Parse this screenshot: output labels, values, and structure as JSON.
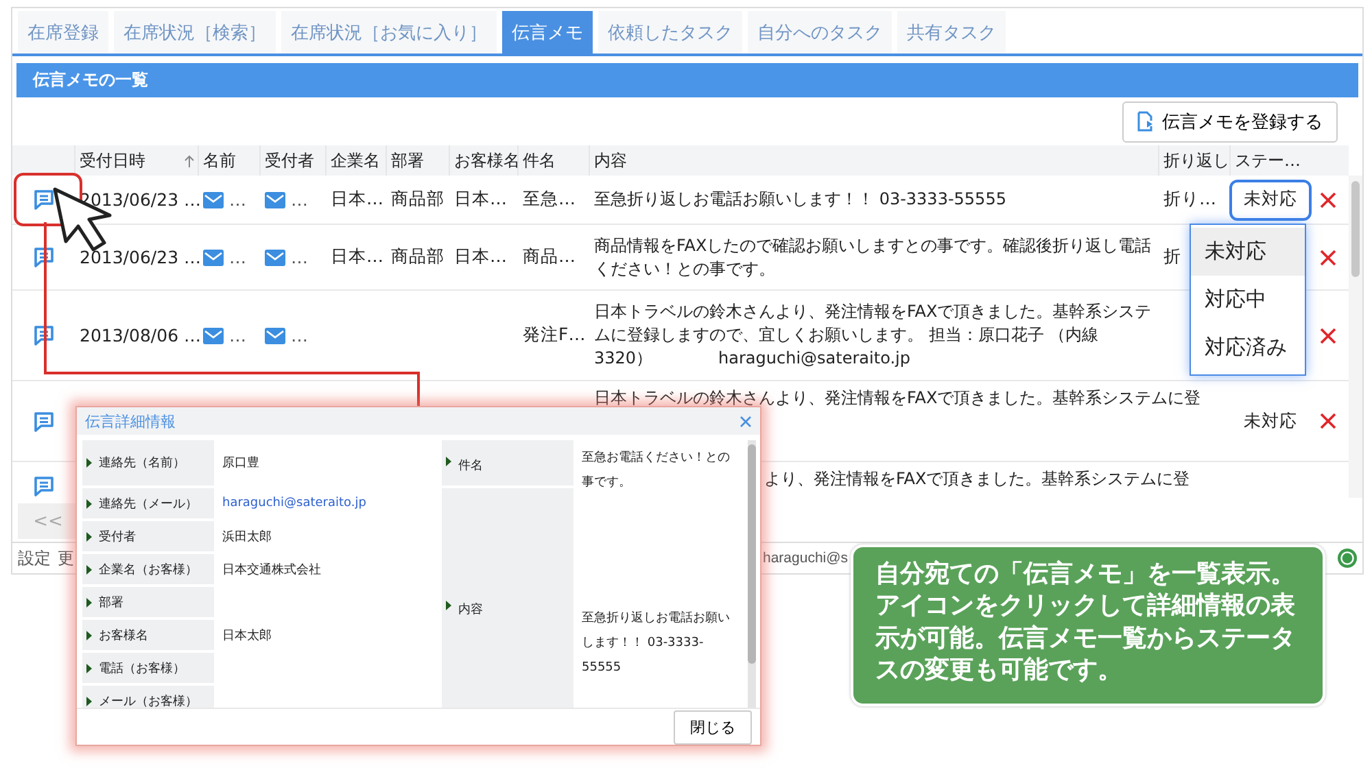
{
  "tabs": [
    {
      "label": "在席登録",
      "selected": false
    },
    {
      "label": "在席状況［検索］",
      "selected": false
    },
    {
      "label": "在席状況［お気に入り］",
      "selected": false
    },
    {
      "label": "伝言メモ",
      "selected": true
    },
    {
      "label": "依頼したタスク",
      "selected": false
    },
    {
      "label": "自分へのタスク",
      "selected": false
    },
    {
      "label": "共有タスク",
      "selected": false
    }
  ],
  "panel_title": "伝言メモの一覧",
  "register_button": "伝言メモを登録する",
  "table": {
    "columns": [
      {
        "label": "受付日時",
        "sorted": true
      },
      {
        "label": "名前",
        "sorted": false
      },
      {
        "label": "受付者",
        "sorted": false
      },
      {
        "label": "企業名",
        "sorted": false
      },
      {
        "label": "部署",
        "sorted": false
      },
      {
        "label": "お客様名",
        "sorted": false
      },
      {
        "label": "件名",
        "sorted": false
      },
      {
        "label": "内容",
        "sorted": false
      },
      {
        "label": "折り返し",
        "sorted": false
      },
      {
        "label": "ステー…",
        "sorted": false
      }
    ],
    "rows": [
      {
        "kind": "full",
        "date": "2013/06/23 …",
        "name": "…",
        "receiver": "…",
        "company": "日本…",
        "department": "商品部",
        "customer": "日本…",
        "subject": "至急…",
        "content": "至急折り返しお電話お願いします！！ 03-3333-55555",
        "callback": "折り…",
        "status": "未対応",
        "status_menu": {
          "open": true,
          "options": [
            {
              "label": "未対応",
              "selected": true
            },
            {
              "label": "対応中",
              "selected": false
            },
            {
              "label": "対応済み",
              "selected": false
            }
          ]
        }
      },
      {
        "kind": "full",
        "date": "2013/06/23 …",
        "name": "…",
        "receiver": "…",
        "company": "日本…",
        "department": "商品部",
        "customer": "日本…",
        "subject": "商品…",
        "content": "商品情報をFAXしたので確認お願いしますとの事です。確認後折り返し電話ください！との事です。",
        "callback": "折"
      },
      {
        "kind": "full",
        "date": "2013/08/06 …",
        "name": "…",
        "receiver": "…",
        "subject": "発注F…",
        "content": "日本トラベルの鈴木さんより、発注情報をFAXで頂きました。基幹系システムに登録しますので、宜しくお願いします。 担当：原口花子 （内線3320）　　　　haraguchi@sateraito.jp"
      },
      {
        "kind": "top",
        "content": "日本トラベルの鈴木さんより、発注情報をFAXで頂きました。基幹系システムに登",
        "status": "未対応"
      },
      {
        "kind": "offset",
        "content": "より、発注情報をFAXで頂きました。基幹系システムに登"
      }
    ]
  },
  "pager": {
    "button": "<<"
  },
  "footer": {
    "links": [
      "設定",
      "更"
    ],
    "account": "haraguchi@s"
  },
  "dialog": {
    "title": "伝言詳細情報",
    "left_fields": [
      {
        "label": "連絡先（名前）",
        "value": "原口豊",
        "kind": "text"
      },
      {
        "label": "連絡先（メール）",
        "value": "haraguchi@sateraito.jp",
        "kind": "link"
      },
      {
        "label": "受付者",
        "value": "浜田太郎",
        "kind": "text"
      },
      {
        "label": "企業名（お客様）",
        "value": "日本交通株式会社",
        "kind": "text"
      },
      {
        "label": "部署",
        "kind": "text"
      },
      {
        "label": "お客様名",
        "value": "日本太郎",
        "kind": "text"
      },
      {
        "label": "電話（お客様）",
        "kind": "text"
      },
      {
        "label": "メール（お客様）",
        "kind": "text"
      }
    ],
    "right_fields": [
      {
        "label": "件名",
        "value": "至急お電話ください！との事です。"
      },
      {
        "label": "内容",
        "value": "至急折り返しお電話お願いします！！ 03-3333-55555"
      }
    ],
    "close_button": "閉じる"
  },
  "callout": "自分宛ての「伝言メモ」を一覧表示。アイコンをクリックして詳細情報の表示が可能。伝言メモ一覧からステータスの変更も可能です。"
}
